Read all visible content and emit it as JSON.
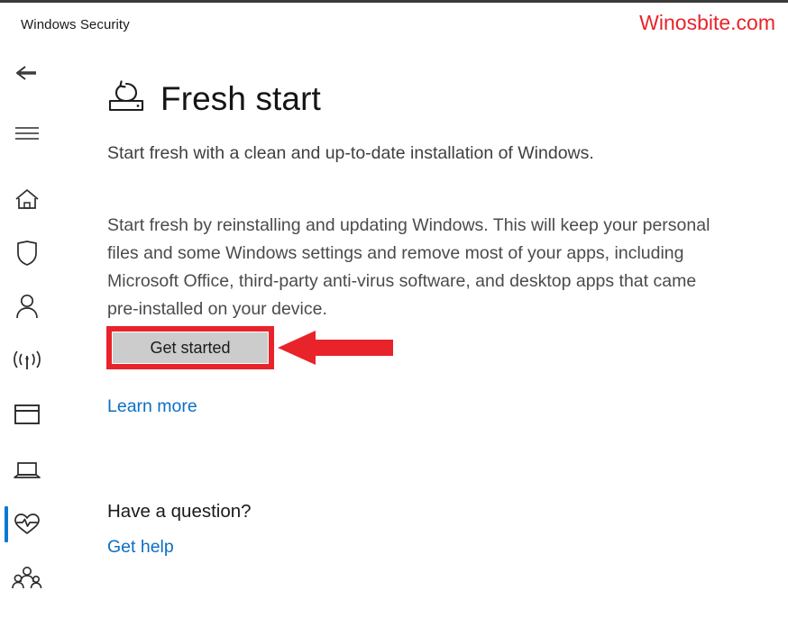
{
  "window": {
    "title": "Windows Security",
    "watermark": "Winosbite.com"
  },
  "sidebar": {
    "active_index": 7,
    "accent_color": "#0c79d0",
    "items": [
      {
        "icon": "back-arrow-icon",
        "label": "Back"
      },
      {
        "icon": "hamburger-menu-icon",
        "label": "Menu"
      },
      {
        "icon": "home-icon",
        "label": "Home"
      },
      {
        "icon": "shield-icon",
        "label": "Virus & threat protection"
      },
      {
        "icon": "person-icon",
        "label": "Account protection"
      },
      {
        "icon": "wireless-signal-icon",
        "label": "Firewall & network protection"
      },
      {
        "icon": "browser-window-icon",
        "label": "App & browser control"
      },
      {
        "icon": "laptop-icon",
        "label": "Device security"
      },
      {
        "icon": "heart-pulse-icon",
        "label": "Device performance & health"
      },
      {
        "icon": "family-people-icon",
        "label": "Family options"
      }
    ]
  },
  "page": {
    "icon": "fresh-start-refresh-icon",
    "title": "Fresh start",
    "subtitle": "Start fresh with a clean and up-to-date installation of Windows.",
    "description": "Start fresh by reinstalling and updating Windows. This will keep your personal files and some Windows settings and remove most of your apps, including Microsoft Office, third-party anti-virus software, and desktop apps that came pre-installed on your device.",
    "primary_button": "Get started",
    "learn_more_link": "Learn more",
    "question_heading": "Have a question?",
    "get_help_link": "Get help"
  },
  "annotation": {
    "color": "#e8232a",
    "highlight_target": "Get started",
    "arrow_direction": "left"
  }
}
